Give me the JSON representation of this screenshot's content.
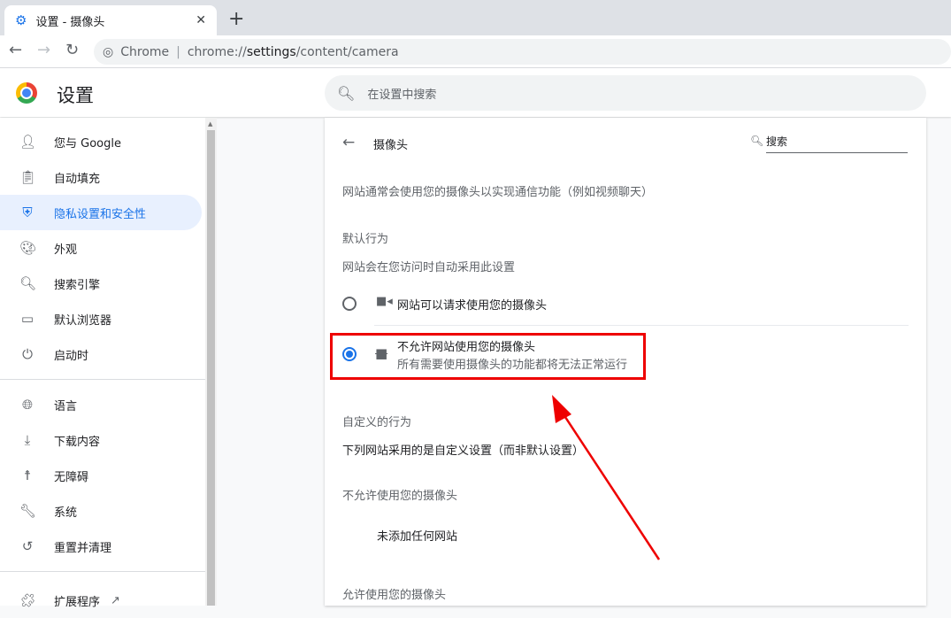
{
  "browser": {
    "tab_title": "设置 - 摄像头",
    "omnibox_label": "Chrome",
    "url_prefix": "chrome://",
    "url_host": "settings",
    "url_path": "/content/camera"
  },
  "header": {
    "title": "设置",
    "search_placeholder": "在设置中搜索"
  },
  "sidebar": {
    "items": [
      {
        "label": "您与 Google",
        "icon": "person-icon"
      },
      {
        "label": "自动填充",
        "icon": "clipboard-icon"
      },
      {
        "label": "隐私设置和安全性",
        "icon": "shield-icon",
        "active": true
      },
      {
        "label": "外观",
        "icon": "palette-icon"
      },
      {
        "label": "搜索引擎",
        "icon": "search-icon"
      },
      {
        "label": "默认浏览器",
        "icon": "browser-icon"
      },
      {
        "label": "启动时",
        "icon": "power-icon"
      },
      {
        "label": "语言",
        "icon": "globe-icon"
      },
      {
        "label": "下载内容",
        "icon": "download-icon"
      },
      {
        "label": "无障碍",
        "icon": "accessibility-icon"
      },
      {
        "label": "系统",
        "icon": "wrench-icon"
      },
      {
        "label": "重置并清理",
        "icon": "history-icon"
      },
      {
        "label": "扩展程序",
        "icon": "puzzle-icon"
      }
    ]
  },
  "page": {
    "title": "摄像头",
    "search_placeholder": "搜索",
    "description": "网站通常会使用您的摄像头以实现通信功能（例如视频聊天）",
    "default_heading": "默认行为",
    "default_sub": "网站会在您访问时自动采用此设置",
    "option_allow": "网站可以请求使用您的摄像头",
    "option_block": "不允许网站使用您的摄像头",
    "option_block_sub": "所有需要使用摄像头的功能都将无法正常运行",
    "selected": "block",
    "custom_heading": "自定义的行为",
    "custom_sub": "下列网站采用的是自定义设置（而非默认设置）",
    "blocked_heading": "不允许使用您的摄像头",
    "blocked_empty": "未添加任何网站",
    "allowed_heading": "允许使用您的摄像头"
  },
  "colors": {
    "accent": "#1a73e8",
    "annotation": "#ee0000"
  }
}
